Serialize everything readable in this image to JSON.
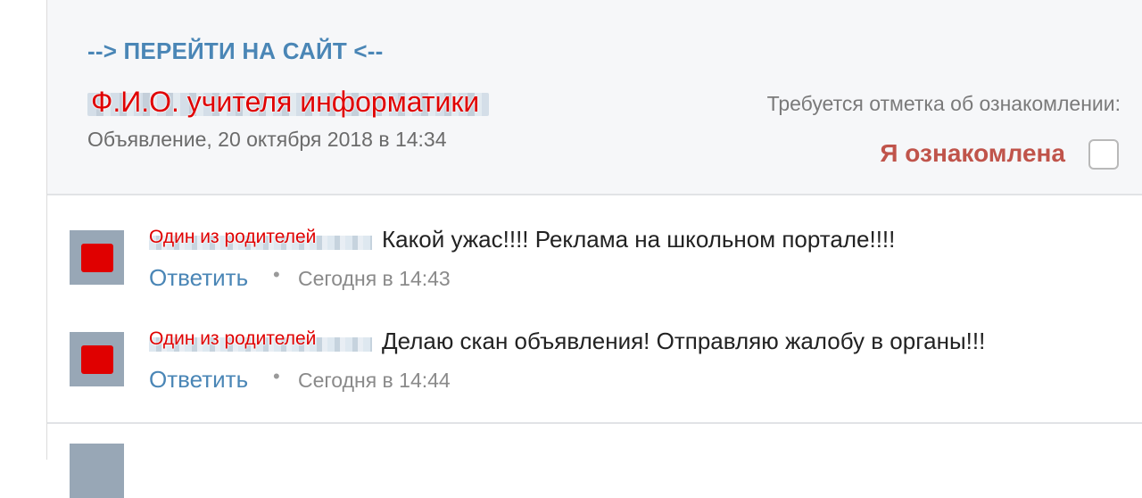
{
  "announcement": {
    "goto_link": "--> ПЕРЕЙТИ НА САЙТ <--",
    "author_label": "Ф.И.О. учителя информатики",
    "date": "Объявление, 20 октября 2018 в 14:34",
    "ack_required": "Требуется отметка об ознакомлении:",
    "ack_label": "Я ознакомлена"
  },
  "comments": [
    {
      "author": "Один из родителей",
      "text": "Какой ужас!!!! Реклама на школьном портале!!!!",
      "reply": "Ответить",
      "separator": "•",
      "time": "Сегодня в 14:43"
    },
    {
      "author": "Один из родителей",
      "text": "Делаю скан объявления! Отправляю жалобу в органы!!!",
      "reply": "Ответить",
      "separator": "•",
      "time": "Сегодня в 14:44"
    }
  ],
  "colors": {
    "link": "#4a86b6",
    "redaction_red": "#e00000",
    "ack_red": "#c0544b",
    "avatar_gray": "#98a7b6"
  }
}
